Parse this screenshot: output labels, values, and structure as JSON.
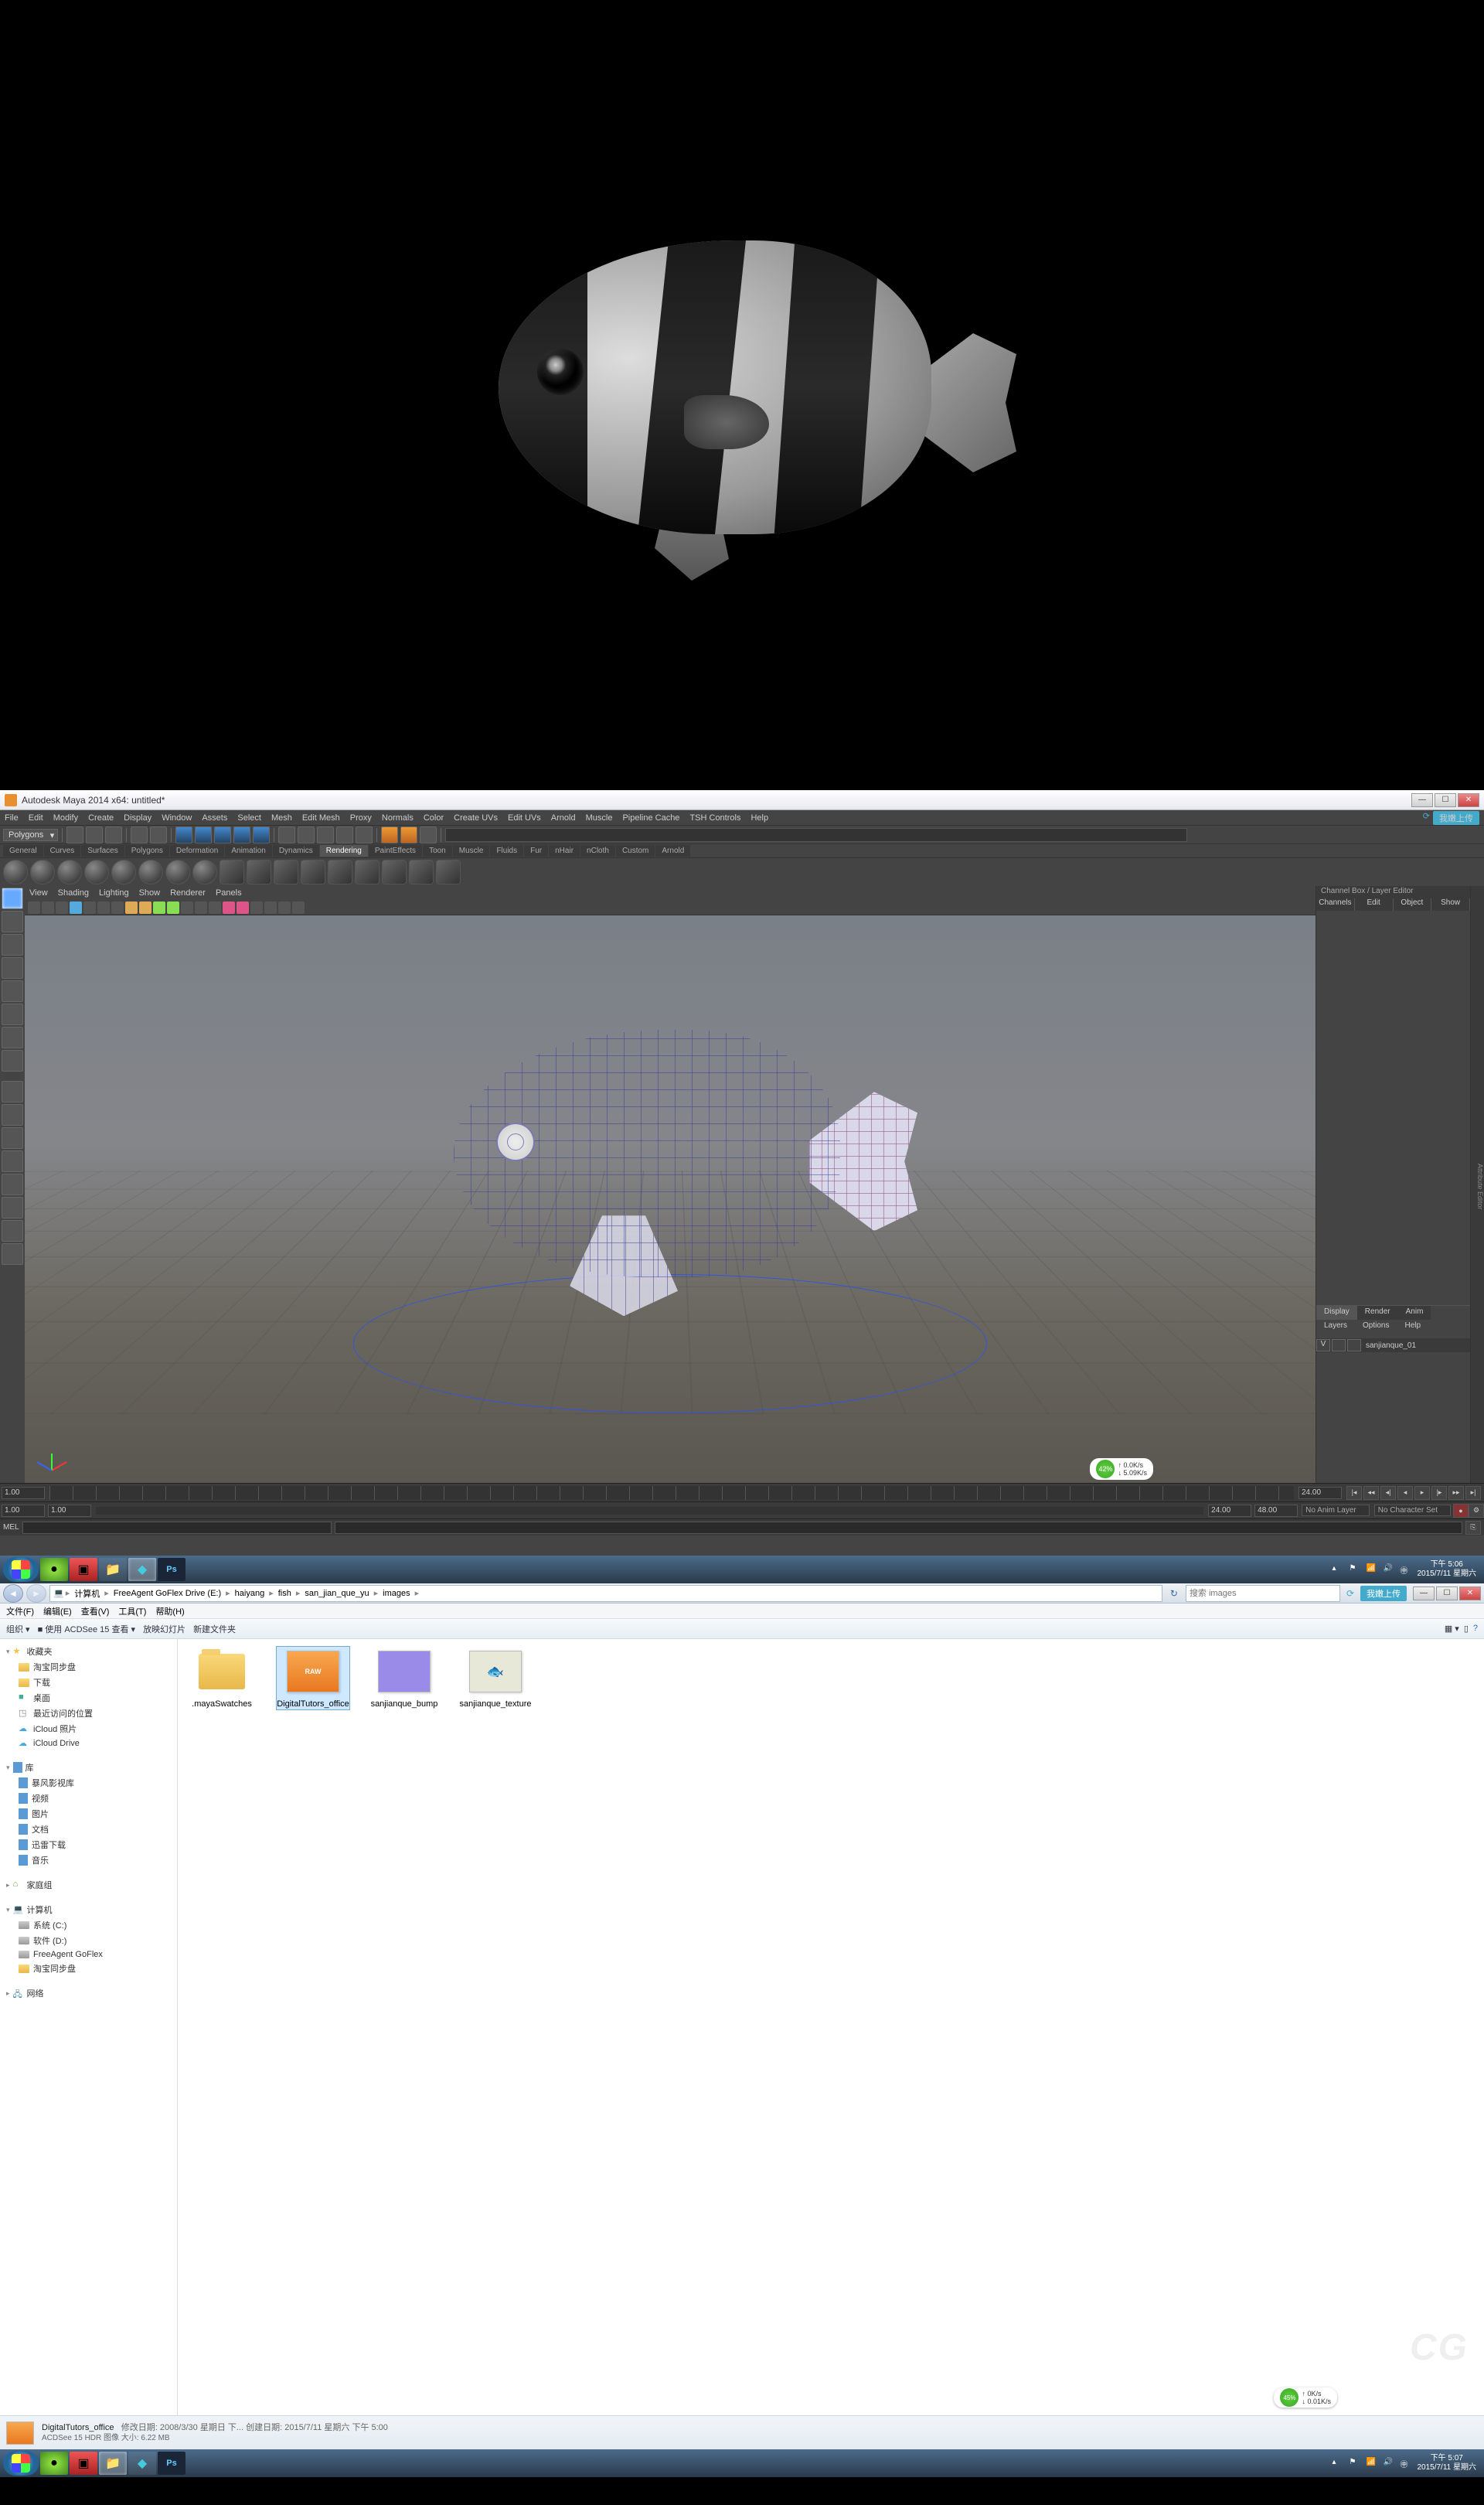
{
  "maya": {
    "title": "Autodesk Maya 2014 x64: untitled*",
    "upload_btn": "我嫩上传",
    "menus": [
      "File",
      "Edit",
      "Modify",
      "Create",
      "Display",
      "Window",
      "Assets",
      "Select",
      "Mesh",
      "Edit Mesh",
      "Proxy",
      "Normals",
      "Color",
      "Create UVs",
      "Edit UVs",
      "Arnold",
      "Muscle",
      "Pipeline Cache",
      "TSH Controls",
      "Help"
    ],
    "mode_dropdown": "Polygons",
    "shelf_tabs": [
      "General",
      "Curves",
      "Surfaces",
      "Polygons",
      "Deformation",
      "Animation",
      "Dynamics",
      "Rendering",
      "PaintEffects",
      "Toon",
      "Muscle",
      "Fluids",
      "Fur",
      "nHair",
      "nCloth",
      "Custom",
      "Arnold"
    ],
    "shelf_active": "Rendering",
    "panel_menus": [
      "View",
      "Shading",
      "Lighting",
      "Show",
      "Renderer",
      "Panels"
    ],
    "channel_box": {
      "title": "Channel Box / Layer Editor",
      "tabs": [
        "Channels",
        "Edit",
        "Object",
        "Show"
      ],
      "layer_tabs": [
        "Display",
        "Render",
        "Anim"
      ],
      "layer_subtabs": [
        "Layers",
        "Options",
        "Help"
      ],
      "layer_name": "sanjianque_01"
    },
    "time": {
      "start": "1.00",
      "end": "24.00",
      "range_end": "48.00",
      "marks": [
        "1",
        "24"
      ]
    },
    "anim_layer": "No Anim Layer",
    "char_set": "No Character Set",
    "cmd_label": "MEL",
    "prefetch": {
      "pct": "42%",
      "up": "0.0K/s",
      "down": "5.09K/s"
    }
  },
  "taskbar1": {
    "tray_time": "下午 5:06",
    "tray_date": "2015/7/11 星期六"
  },
  "explorer": {
    "breadcrumb": [
      "计算机",
      "FreeAgent GoFlex Drive (E:)",
      "haiyang",
      "fish",
      "san_jian_que_yu",
      "images"
    ],
    "search_placeholder": "搜索 images",
    "upload_btn": "我嫩上传",
    "menus": [
      "文件(F)",
      "编辑(E)",
      "查看(V)",
      "工具(T)",
      "帮助(H)"
    ],
    "toolbar": [
      "组织 ▾",
      "■ 使用 ACDSee 15 查看 ▾",
      "放映幻灯片",
      "新建文件夹"
    ],
    "nav": {
      "favorites": {
        "label": "收藏夹",
        "items": [
          "淘宝同步盘",
          "下载",
          "桌面",
          "最近访问的位置",
          "iCloud 照片",
          "iCloud Drive"
        ]
      },
      "libraries": {
        "label": "库",
        "items": [
          "暴风影视库",
          "视频",
          "图片",
          "文档",
          "迅雷下载",
          "音乐"
        ]
      },
      "homegroup": {
        "label": "家庭组"
      },
      "computer": {
        "label": "计算机",
        "items": [
          "系统 (C:)",
          "软件 (D:)",
          "FreeAgent GoFlex",
          "淘宝同步盘"
        ]
      },
      "network": {
        "label": "网络"
      }
    },
    "files": [
      {
        "name": ".mayaSwatches",
        "type": "folder"
      },
      {
        "name": "DigitalTutors_office",
        "type": "hdr",
        "selected": true
      },
      {
        "name": "sanjianque_bump",
        "type": "purple"
      },
      {
        "name": "sanjianque_texture",
        "type": "beige"
      }
    ],
    "status": {
      "filename": "DigitalTutors_office",
      "line1": "修改日期: 2008/3/30 星期日 下...    创建日期: 2015/7/11 星期六 下午 5:00",
      "line2": "ACDSee 15 HDR 图像    大小: 6.22 MB"
    },
    "prefetch": {
      "pct": "45%",
      "up": "0K/s",
      "down": "0.01K/s"
    }
  },
  "taskbar2": {
    "tray_time": "下午 5:07",
    "tray_date": "2015/7/11 星期六"
  }
}
